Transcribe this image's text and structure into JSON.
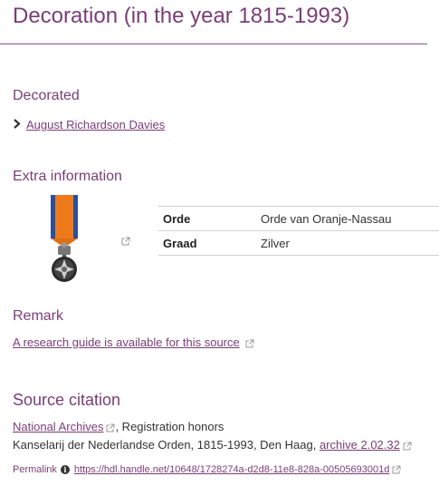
{
  "page": {
    "title": "Decoration (in the year 1815-1993)"
  },
  "decorated": {
    "heading": "Decorated",
    "person": "August Richardson Davies"
  },
  "extra": {
    "heading": "Extra information",
    "rows": [
      {
        "key": "Orde",
        "value": "Orde van Oranje-Nassau"
      },
      {
        "key": "Graad",
        "value": "Zilver"
      }
    ]
  },
  "remark": {
    "heading": "Remark",
    "link": "A research guide is available for this source"
  },
  "citation": {
    "heading": "Source citation",
    "archive_link": "National Archives",
    "line1_suffix": ", Registration honors",
    "line2_prefix": "Kanselarij der Nederlandse Orden, 1815-1993, Den Haag,",
    "archive_number": "archive 2.02.32",
    "permalink_label": "Permalink",
    "permalink_url": "https://hdl.handle.net/10648/1728274a-d2d8-11e8-828a-00505693001d"
  },
  "colors": {
    "accent": "#7a3d79",
    "ribbon_orange": "#ee7a1c",
    "ribbon_blue": "#2a4f9e"
  },
  "icons": [
    "chevron-right-icon",
    "external-link-icon",
    "info-icon",
    "medal-image"
  ]
}
